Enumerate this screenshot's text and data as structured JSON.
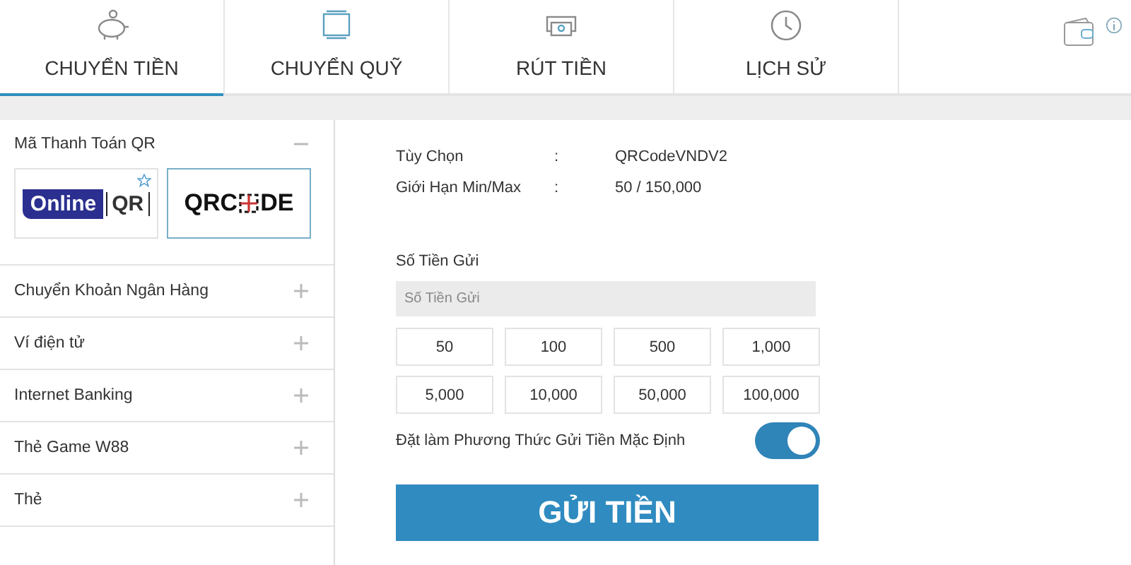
{
  "tabs": [
    {
      "label": "CHUYỂN TIỀN",
      "kind": "piggy",
      "selected": true
    },
    {
      "label": "CHUYỂN QUỸ",
      "kind": "transfer",
      "selected": false
    },
    {
      "label": "RÚT TIỀN",
      "kind": "cash",
      "selected": false
    },
    {
      "label": "LỊCH SỬ",
      "kind": "history",
      "selected": false
    }
  ],
  "sidebar": {
    "sections": [
      {
        "label": "Mã Thanh Toán QR",
        "expanded": true,
        "options": [
          {
            "kind": "online",
            "parts": [
              "Online",
              "QR"
            ],
            "selected": false,
            "starred": true
          },
          {
            "kind": "qrcode",
            "parts": [
              "QRC",
              "DE"
            ],
            "selected": true,
            "starred": false
          }
        ]
      },
      {
        "label": "Chuyển Khoản Ngân Hàng",
        "expanded": false
      },
      {
        "label": "Ví điện tử",
        "expanded": false
      },
      {
        "label": "Internet Banking",
        "expanded": false
      },
      {
        "label": "Thẻ Game W88",
        "expanded": false
      },
      {
        "label": "Thẻ",
        "expanded": false
      }
    ]
  },
  "info": [
    {
      "label": "Tùy Chọn",
      "separator": ":",
      "value": "QRCodeVNDV2"
    },
    {
      "label": "Giới Hạn Min/Max",
      "separator": ":",
      "value": "50 / 150,000"
    }
  ],
  "amount": {
    "label": "Số Tiền Gửi",
    "placeholder": "Số Tiền Gửi",
    "presets": [
      "50",
      "100",
      "500",
      "1,000",
      "5,000",
      "10,000",
      "50,000",
      "100,000"
    ]
  },
  "default_toggle": {
    "label": "Đặt làm Phương Thức Gửi Tiền Mặc Định",
    "on": true
  },
  "submit": "GỬI TIỀN"
}
